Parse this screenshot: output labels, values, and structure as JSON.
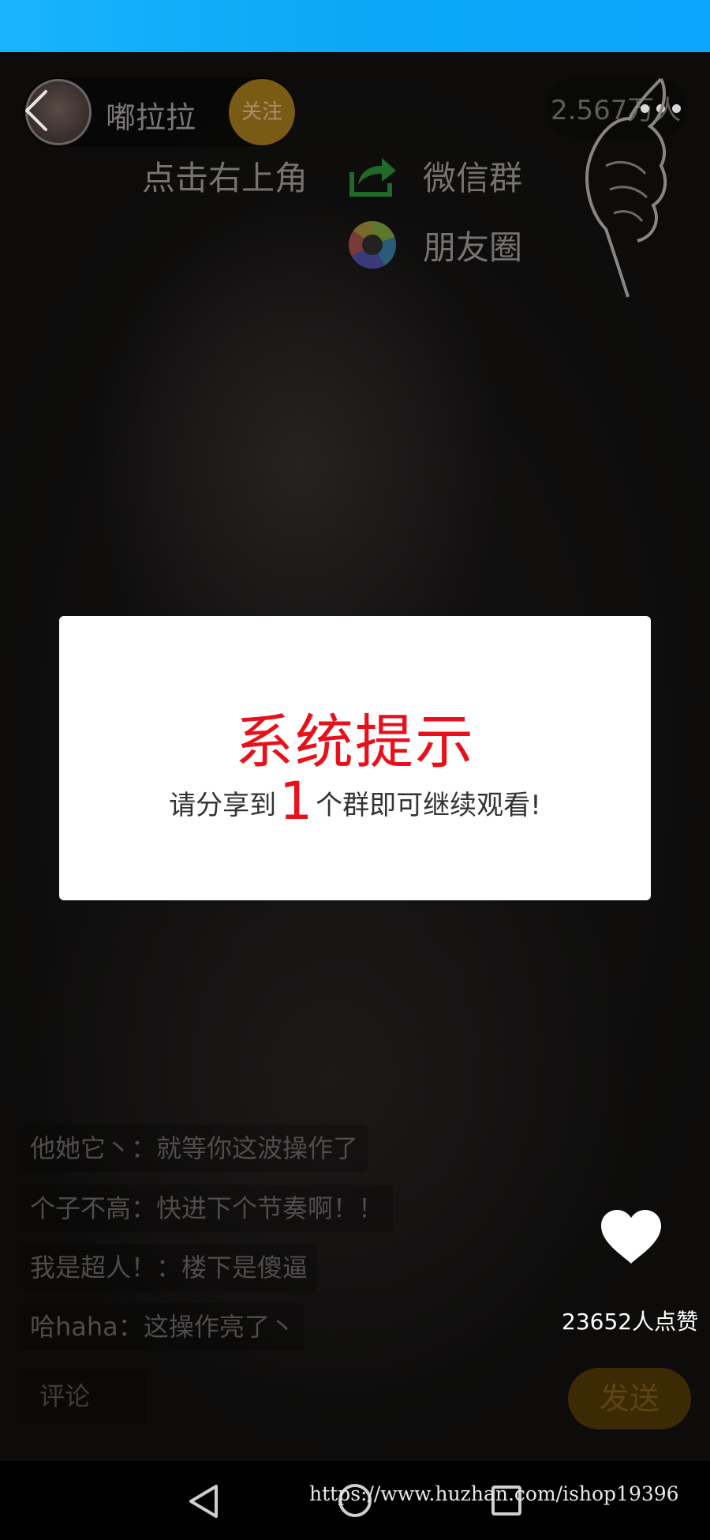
{
  "header": {
    "host_name": "嘟拉拉",
    "follow_label": "关注",
    "viewer_count": "2.567万人"
  },
  "share_guide": {
    "instruction": "点击右上角",
    "wechat_group": "微信群",
    "moments": "朋友圈"
  },
  "modal": {
    "title": "系统提示",
    "message_before": "请分享到",
    "share_count": "1",
    "message_after": "个群即可继续观看!"
  },
  "chat": [
    {
      "user": "他她它丶",
      "text": "就等你这波操作了"
    },
    {
      "user": "个子不高",
      "text": "快进下个节奏啊！！"
    },
    {
      "user": "我是超人！",
      "text": "楼下是傻逼"
    },
    {
      "user": "哈haha",
      "text": "这操作亮了丶"
    }
  ],
  "likes": {
    "count_text": "23652人点赞"
  },
  "composer": {
    "placeholder": "评论",
    "send_label": "发送"
  },
  "watermark": "https://www.huzhan.com/ishop19396",
  "colors": {
    "status_bar": "#0aa8f5",
    "accent_red": "#e8101a",
    "follow_gold": "#7a5b16"
  },
  "icons": [
    "back-icon",
    "more-icon",
    "wechat-share-icon",
    "moments-icon",
    "hand-icon",
    "heart-icon",
    "nav-back-icon",
    "nav-home-icon",
    "nav-recent-icon"
  ]
}
